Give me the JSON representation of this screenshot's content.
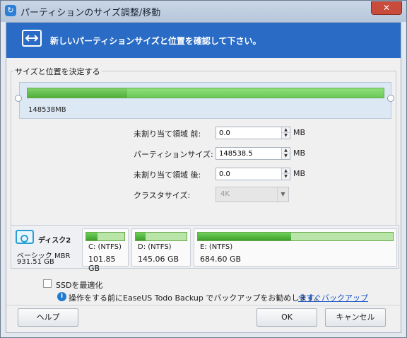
{
  "window": {
    "title": "パーティションのサイズ調整/移動",
    "close": "✕"
  },
  "banner": {
    "text": "新しいパーティションサイズと位置を確認して下さい。"
  },
  "group": {
    "legend": "サイズと位置を決定する"
  },
  "partition_bar": {
    "size_label": "148538MB",
    "used_fraction": 0.28
  },
  "form": {
    "before_label": "未割り当て領域 前:",
    "before_value": "0.0",
    "size_label": "パーティションサイズ:",
    "size_value": "148538.5",
    "after_label": "未割り当て領域 後:",
    "after_value": "0.0",
    "unit": "MB",
    "cluster_label": "クラスタサイズ:",
    "cluster_value": "4K"
  },
  "disk": {
    "name": "ディスク2",
    "type": "ベーシック MBR",
    "capacity": "931.51 GB",
    "partitions": [
      {
        "label": "C: (NTFS)",
        "size": "101.85 GB",
        "used_fraction": 0.3
      },
      {
        "label": "D: (NTFS)",
        "size": "145.06 GB",
        "used_fraction": 0.2
      },
      {
        "label": "E: (NTFS)",
        "size": "684.60 GB",
        "used_fraction": 0.48
      }
    ]
  },
  "options": {
    "ssd_label": "SSDを最適化"
  },
  "info": {
    "text": "操作をする前にEaseUS Todo Backup でバックアップをお勧めします。",
    "link": "今すぐバックアップ"
  },
  "buttons": {
    "help": "ヘルプ",
    "ok": "OK",
    "cancel": "キャンセル"
  }
}
